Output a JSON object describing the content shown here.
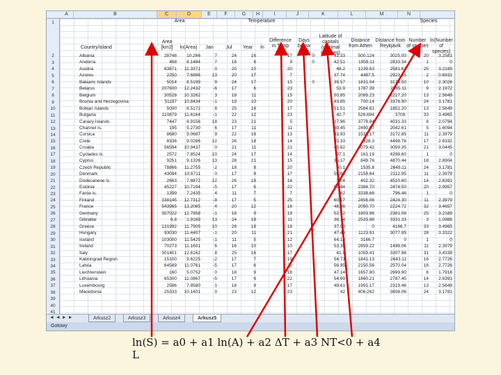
{
  "columns": [
    "A",
    "B",
    "C",
    "D",
    "E",
    "F",
    "G",
    "H",
    "I",
    "J",
    "K",
    "L",
    "M",
    "N"
  ],
  "header_groups": {
    "area": "Area",
    "temperature": "Temperature",
    "species": "Species"
  },
  "headers": {
    "country": "Country/island",
    "area": "Area [km2]",
    "ln_area": "ln(Area)",
    "jan": "Jan",
    "jul": "Jul",
    "year": "Year",
    "ln": "ln",
    "diff": "Difference in Temp",
    "days": "Days below zero",
    "lat": "Latitude of capitals (decimal degrees)",
    "athen": "Distance from Athen",
    "reyk": "Distance from Reykjavik",
    "num": "Number of species",
    "ln_num": "ln(Number of species)"
  },
  "row_numbers": [
    "1",
    "2",
    "3",
    "4",
    "5",
    "6",
    "7",
    "8",
    "9",
    "10",
    "11",
    "12",
    "13",
    "14",
    "15",
    "16",
    "17",
    "18",
    "19",
    "20",
    "21",
    "22",
    "23",
    "24",
    "25",
    "26",
    "27",
    "28",
    "29",
    "30",
    "31",
    "32",
    "33",
    "34",
    "35",
    "36",
    "37",
    "38",
    "39",
    "40",
    "41"
  ],
  "rows": [
    [
      "Albania",
      "28748",
      "10.266",
      "7",
      "24",
      "16",
      "",
      "17",
      "0",
      "41.33",
      "500.124",
      "3025.00",
      "20",
      "3.2581"
    ],
    [
      "Andorra",
      "468",
      "6.1484",
      "7",
      "16",
      "8",
      "",
      "9",
      "0",
      "42.51",
      "1959.11",
      "2833.34",
      "1",
      "0"
    ],
    [
      "Austria",
      "83871",
      "11.3371",
      "0",
      "20",
      "10",
      "",
      "20",
      "",
      "48.2",
      "1239.63",
      "2581.62",
      "25",
      "3.2189"
    ],
    [
      "Azores",
      "2250",
      "7.6896",
      "13",
      "20",
      "17",
      "",
      "7",
      "",
      "37.74",
      "4487.5",
      "2923.55",
      "2",
      "0.6931"
    ],
    [
      "Balearic Islands",
      "5014",
      "8.5199",
      "9",
      "24",
      "17",
      "",
      "15",
      "0",
      "39.57",
      "1831.04",
      "3174.50",
      "10",
      "2.3026"
    ],
    [
      "Belarus",
      "207600",
      "12.2432",
      "-6",
      "17",
      "6",
      "",
      "23",
      "",
      "53.9",
      "1787.39",
      "2565.11",
      "9",
      "2.1972"
    ],
    [
      "Belgium",
      "30528",
      "10.3262",
      "3",
      "18",
      "11",
      "",
      "15",
      "",
      "50.85",
      "2089.23",
      "2217.20",
      "13",
      "2.5649"
    ],
    [
      "Bosnia and Herzegovina",
      "51197",
      "10.8434",
      "-1",
      "19",
      "10",
      "",
      "20",
      "",
      "43.85",
      "700.14",
      "3376.90",
      "24",
      "3.1781"
    ],
    [
      "Bolkan Islands",
      "5000",
      "8.5172",
      "8",
      "25",
      "16",
      "",
      "17",
      "",
      "51.51",
      "2584.81",
      "1851.20",
      "13",
      "2.5649"
    ],
    [
      "Bulgaria",
      "110879",
      "11.6164",
      "-1",
      "22",
      "12",
      "",
      "23",
      "",
      "42.7",
      "526.694",
      "3709.",
      "33",
      "3.4965"
    ],
    [
      "Canary Islands",
      "7447",
      "8.9156",
      "18",
      "23",
      "21",
      "",
      "5",
      "",
      "27.96",
      "3778.84",
      "4031.33",
      "8",
      "2.0794"
    ],
    [
      "Channel Is.",
      "195",
      "5.2730",
      "6",
      "17",
      "11",
      "",
      "11",
      "",
      "49.45",
      "2490.07",
      "2042.61",
      "5",
      "1.6094"
    ],
    [
      "Corsica",
      "8680",
      "9.0687",
      "9",
      "22",
      "16",
      "",
      "13",
      "",
      "41.93",
      "1533.17",
      "3172.85",
      "11",
      "2.3979"
    ],
    [
      "Crete",
      "8336",
      "9.0286",
      "12",
      "26",
      "18",
      "",
      "14",
      "",
      "35.33",
      "328.3",
      "4498.76",
      "17",
      "2.8332"
    ],
    [
      "Croatia",
      "56594",
      "10.9437",
      "0",
      "21",
      "11",
      "",
      "21",
      "",
      "45.82",
      "1079.42",
      "3059.35",
      "21",
      "3.0445"
    ],
    [
      "Cyclades is.",
      "2572",
      "7.8524",
      "10",
      "24",
      "17",
      "",
      "14",
      "",
      "37.1",
      "161.19",
      "4298.60",
      "1",
      "0"
    ],
    [
      "Cyprus",
      "9251",
      "9.1326",
      "13",
      "28",
      "21",
      "",
      "15",
      "",
      "35.17",
      "849.76",
      "4870.44",
      "18",
      "2.8904"
    ],
    [
      "Czech Republic",
      "78866",
      "11.2755",
      "-2",
      "18",
      "8",
      "",
      "20",
      "",
      "50.1",
      "1535.8",
      "2649.11",
      "24",
      "3.1781"
    ],
    [
      "Denmark",
      "43094",
      "10.6711",
      "0",
      "17",
      "8",
      "",
      "17",
      "",
      "55.68",
      "2158.64",
      "2112.95",
      "11",
      "2.3979"
    ],
    [
      "Dodecanese is.",
      "2663",
      "7.8872",
      "12",
      "26",
      "18",
      "",
      "14",
      "",
      "36.4",
      "402.32",
      "4510.60",
      "14",
      "2.6391"
    ],
    [
      "Estonia",
      "45227",
      "10.7194",
      "-5",
      "17",
      "6",
      "",
      "22",
      "",
      "59.44",
      "2384.70",
      "2474.50",
      "20",
      "2.9957"
    ],
    [
      "Faroe is.",
      "1399",
      "7.2435",
      "4",
      "11",
      "7",
      "",
      "7",
      "",
      "62",
      "3338.66",
      "796.46",
      "1",
      "0"
    ],
    [
      "Finland",
      "338145",
      "12.7312",
      "-8",
      "17",
      "5",
      "",
      "25",
      "",
      "60.17",
      "2456.06",
      "2424.30",
      "11",
      "2.3979"
    ],
    [
      "France",
      "543965",
      "13.2065",
      "4",
      "20",
      "12",
      "",
      "16",
      "",
      "48.86",
      "2090.70",
      "2224.72",
      "32",
      "3.4657"
    ],
    [
      "Germany",
      "357022",
      "12.7858",
      "-1",
      "18",
      "9",
      "",
      "19",
      "",
      "52.52",
      "1803.96",
      "2381.06",
      "25",
      "3.2189"
    ],
    [
      "Gibraltar",
      "6.8",
      "1.9169",
      "13",
      "24",
      "18",
      "",
      "11",
      "",
      "36.14",
      "2533.88",
      "3331.33",
      "3",
      "1.0986"
    ],
    [
      "Greece",
      "131992",
      "11.7905",
      "10",
      "28",
      "18",
      "",
      "18",
      "",
      "37.98",
      "0",
      "4166.7",
      "33",
      "3.4965"
    ],
    [
      "Hungary",
      "93030",
      "11.4407",
      "-1",
      "20",
      "11",
      "",
      "21",
      "",
      "47.49",
      "1123.91",
      "3077.95",
      "28",
      "3.3322"
    ],
    [
      "Iceland",
      "103000",
      "11.5425",
      "-1",
      "11",
      "5",
      "",
      "12",
      "",
      "64.13",
      "3166.7",
      "0",
      "1",
      "0"
    ],
    [
      "Ireland",
      "70273",
      "11.1601",
      "6",
      "16",
      "10",
      "",
      "10",
      "",
      "53.35",
      "2859.22",
      "1498.06",
      "11",
      "2.3979"
    ],
    [
      "Italy",
      "301401",
      "12.6162",
      "8",
      "25",
      "16",
      "",
      "17",
      "",
      "41.9",
      "1059.41",
      "3307.98",
      "31",
      "3.4339"
    ],
    [
      "Kaliningrad Region",
      "15100",
      "9.6225",
      "-2",
      "17",
      "7",
      "",
      "19",
      "",
      "54.71",
      "1841.13",
      "2643.11",
      "16",
      "2.7726"
    ],
    [
      "Latvia",
      "64589",
      "11.0761",
      "-5",
      "17",
      "6",
      "",
      "22",
      "",
      "56.95",
      "2150.56",
      "2570.04",
      "16",
      "2.7726"
    ],
    [
      "Liechtenstein",
      "160",
      "5.0752",
      "0",
      "18",
      "9",
      "",
      "18",
      "",
      "47.14",
      "1657.80",
      "2699.90",
      "6",
      "1.7918"
    ],
    [
      "Lithuania",
      "65300",
      "11.0867",
      "-5",
      "17",
      "6",
      "",
      "22",
      "",
      "54.69",
      "1860.21",
      "2787.45",
      "14",
      "2.6391"
    ],
    [
      "Luxembourg",
      "2586",
      "7.8580",
      "1",
      "18",
      "9",
      "",
      "17",
      "",
      "49.61",
      "1991.17",
      "2319.46",
      "13",
      "2.5649"
    ],
    [
      "Macedonia",
      "25333",
      "10.1401",
      "0",
      "23",
      "12",
      "",
      "23",
      "",
      "42",
      "406.262",
      "3608.06",
      "24",
      "3.1781"
    ]
  ],
  "tabs": {
    "nav": "◄ ◄ ► ►",
    "items": [
      "Arkusz2",
      "Arkusz3",
      "Arkusz4",
      "Arkusz5"
    ],
    "active_index": 3
  },
  "status": "Gotowy",
  "formula": {
    "text": "ln(S) = a0 + a1 ln(A) + a2 ΔT + a3 NT<0 + a4 L"
  },
  "colors": {
    "arrow": "#e00000",
    "background": "#fbf5de",
    "selected_col": "#f7d58a"
  }
}
